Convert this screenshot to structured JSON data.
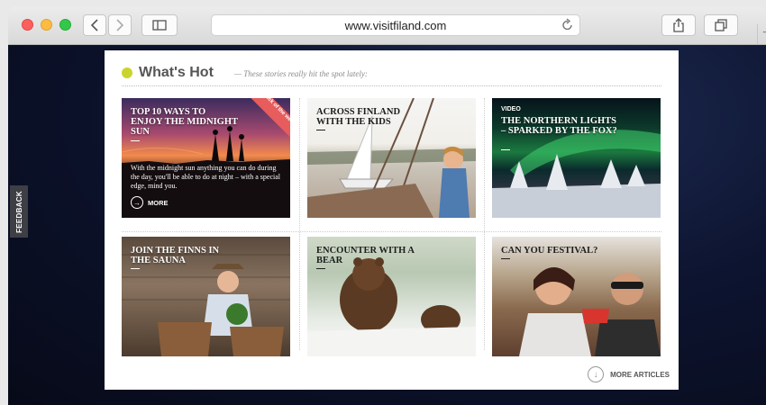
{
  "browser": {
    "url": "www.visitfiland.com",
    "new_tab": "+"
  },
  "feedback": "FEEDBACK",
  "section": {
    "title": "What's Hot",
    "tagline": "— These stories really hit the spot lately:"
  },
  "cards": [
    {
      "title": "Top 10 ways to enjoy the midnight sun",
      "badge": "Pick of the week",
      "description": "With the midnight sun anything you can do during the day, you'll be able to do at night – with a special edge, mind you.",
      "more": "MORE",
      "more_icon": "arrow-right-circle"
    },
    {
      "title": "Across Finland with the kids"
    },
    {
      "label": "VIDEO",
      "title": "The Northern lights – sparked by the fox?"
    },
    {
      "title": "Join the Finns in the sauna"
    },
    {
      "title": "Encounter with a bear"
    },
    {
      "title": "Can you festival?"
    }
  ],
  "more_articles": "MORE ARTICLES",
  "more_articles_icon": "arrow-down-circle"
}
